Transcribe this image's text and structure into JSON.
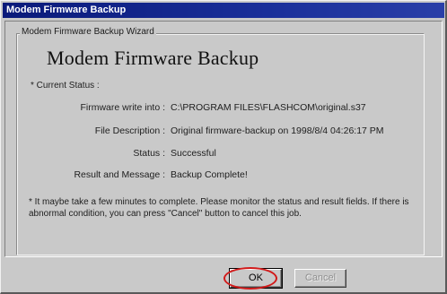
{
  "window": {
    "title": "Modem Firmware Backup",
    "subtitle": "Modem Firmware Backup Wizard",
    "heading": "Modem Firmware Backup"
  },
  "status": {
    "header": "* Current Status :",
    "rows": [
      {
        "label": "Firmware write into :",
        "value": "C:\\PROGRAM FILES\\FLASHCOM\\original.s37"
      },
      {
        "label": "File Description :",
        "value": "Original firmware-backup on 1998/8/4 04:26:17 PM"
      },
      {
        "label": "Status :",
        "value": "Successful"
      },
      {
        "label": "Result and Message :",
        "value": "Backup Complete!"
      }
    ]
  },
  "note": "* It maybe take a few minutes to complete. Please monitor the status and result fields. If there is abnormal condition, you can press \"Cancel\" button to cancel this job.",
  "buttons": {
    "ok": "OK",
    "cancel": "Cancel",
    "highlight_color": "#d21a1a"
  }
}
